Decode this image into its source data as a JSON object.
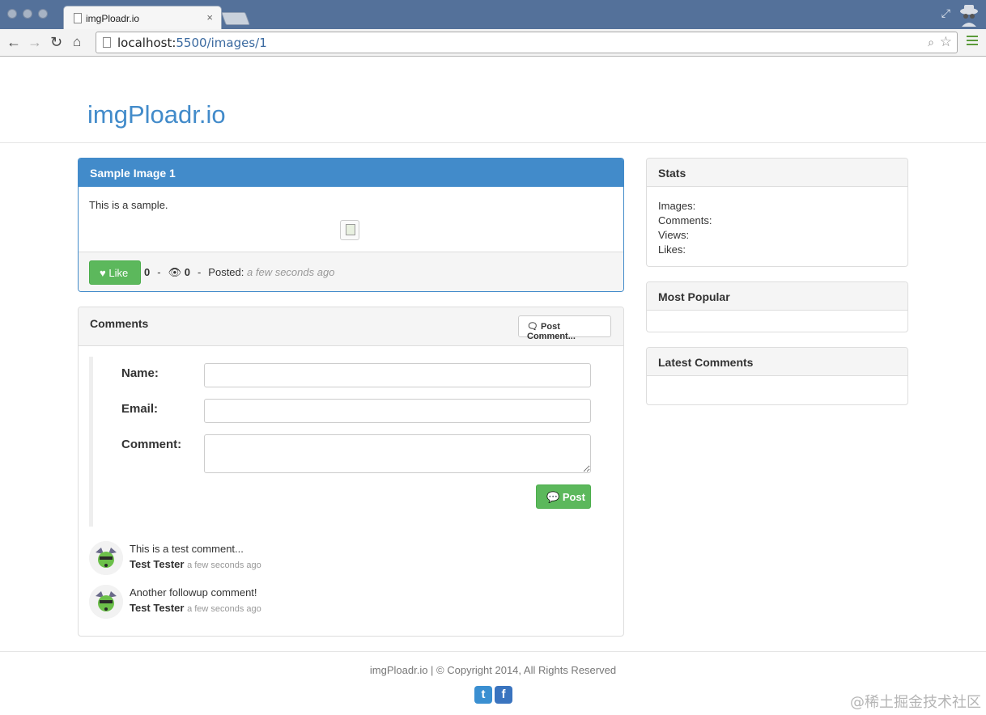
{
  "browser": {
    "tab_title": "imgPloadr.io",
    "tab_close": "×",
    "url_host": "localhost:",
    "url_path": "5500/images/1"
  },
  "site": {
    "brand": "imgPloadr.io"
  },
  "image": {
    "title": "Sample Image 1",
    "description": "This is a sample.",
    "like_label": "Like",
    "likes": "0",
    "views": "0",
    "posted_label": "Posted:",
    "posted_time": "a few seconds ago"
  },
  "comments": {
    "heading": "Comments",
    "post_comment_button": "Post Comment...",
    "form": {
      "name_label": "Name:",
      "email_label": "Email:",
      "comment_label": "Comment:",
      "post_button": "Post"
    },
    "items": [
      {
        "text": "This is a test comment...",
        "author": "Test Tester",
        "time": "a few seconds ago"
      },
      {
        "text": "Another followup comment!",
        "author": "Test Tester",
        "time": "a few seconds ago"
      }
    ]
  },
  "sidebar": {
    "stats": {
      "heading": "Stats",
      "images_label": "Images:",
      "comments_label": "Comments:",
      "views_label": "Views:",
      "likes_label": "Likes:"
    },
    "most_popular": {
      "heading": "Most Popular"
    },
    "latest_comments": {
      "heading": "Latest Comments"
    }
  },
  "footer": {
    "text": "imgPloadr.io | © Copyright 2014, All Rights Reserved"
  },
  "watermark": "@稀土掘金技术社区",
  "colors": {
    "brand": "#428bca",
    "success": "#5cb85c",
    "titlebar": "#54719a"
  }
}
